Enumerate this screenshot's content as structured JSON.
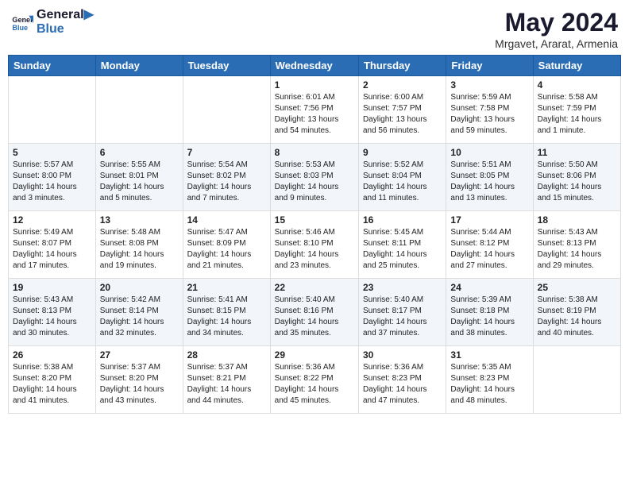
{
  "header": {
    "logo_line1": "General",
    "logo_line2": "Blue",
    "month_year": "May 2024",
    "location": "Mrgavet, Ararat, Armenia"
  },
  "days_of_week": [
    "Sunday",
    "Monday",
    "Tuesday",
    "Wednesday",
    "Thursday",
    "Friday",
    "Saturday"
  ],
  "weeks": [
    [
      {
        "day": "",
        "info": ""
      },
      {
        "day": "",
        "info": ""
      },
      {
        "day": "",
        "info": ""
      },
      {
        "day": "1",
        "info": "Sunrise: 6:01 AM\nSunset: 7:56 PM\nDaylight: 13 hours\nand 54 minutes."
      },
      {
        "day": "2",
        "info": "Sunrise: 6:00 AM\nSunset: 7:57 PM\nDaylight: 13 hours\nand 56 minutes."
      },
      {
        "day": "3",
        "info": "Sunrise: 5:59 AM\nSunset: 7:58 PM\nDaylight: 13 hours\nand 59 minutes."
      },
      {
        "day": "4",
        "info": "Sunrise: 5:58 AM\nSunset: 7:59 PM\nDaylight: 14 hours\nand 1 minute."
      }
    ],
    [
      {
        "day": "5",
        "info": "Sunrise: 5:57 AM\nSunset: 8:00 PM\nDaylight: 14 hours\nand 3 minutes."
      },
      {
        "day": "6",
        "info": "Sunrise: 5:55 AM\nSunset: 8:01 PM\nDaylight: 14 hours\nand 5 minutes."
      },
      {
        "day": "7",
        "info": "Sunrise: 5:54 AM\nSunset: 8:02 PM\nDaylight: 14 hours\nand 7 minutes."
      },
      {
        "day": "8",
        "info": "Sunrise: 5:53 AM\nSunset: 8:03 PM\nDaylight: 14 hours\nand 9 minutes."
      },
      {
        "day": "9",
        "info": "Sunrise: 5:52 AM\nSunset: 8:04 PM\nDaylight: 14 hours\nand 11 minutes."
      },
      {
        "day": "10",
        "info": "Sunrise: 5:51 AM\nSunset: 8:05 PM\nDaylight: 14 hours\nand 13 minutes."
      },
      {
        "day": "11",
        "info": "Sunrise: 5:50 AM\nSunset: 8:06 PM\nDaylight: 14 hours\nand 15 minutes."
      }
    ],
    [
      {
        "day": "12",
        "info": "Sunrise: 5:49 AM\nSunset: 8:07 PM\nDaylight: 14 hours\nand 17 minutes."
      },
      {
        "day": "13",
        "info": "Sunrise: 5:48 AM\nSunset: 8:08 PM\nDaylight: 14 hours\nand 19 minutes."
      },
      {
        "day": "14",
        "info": "Sunrise: 5:47 AM\nSunset: 8:09 PM\nDaylight: 14 hours\nand 21 minutes."
      },
      {
        "day": "15",
        "info": "Sunrise: 5:46 AM\nSunset: 8:10 PM\nDaylight: 14 hours\nand 23 minutes."
      },
      {
        "day": "16",
        "info": "Sunrise: 5:45 AM\nSunset: 8:11 PM\nDaylight: 14 hours\nand 25 minutes."
      },
      {
        "day": "17",
        "info": "Sunrise: 5:44 AM\nSunset: 8:12 PM\nDaylight: 14 hours\nand 27 minutes."
      },
      {
        "day": "18",
        "info": "Sunrise: 5:43 AM\nSunset: 8:13 PM\nDaylight: 14 hours\nand 29 minutes."
      }
    ],
    [
      {
        "day": "19",
        "info": "Sunrise: 5:43 AM\nSunset: 8:13 PM\nDaylight: 14 hours\nand 30 minutes."
      },
      {
        "day": "20",
        "info": "Sunrise: 5:42 AM\nSunset: 8:14 PM\nDaylight: 14 hours\nand 32 minutes."
      },
      {
        "day": "21",
        "info": "Sunrise: 5:41 AM\nSunset: 8:15 PM\nDaylight: 14 hours\nand 34 minutes."
      },
      {
        "day": "22",
        "info": "Sunrise: 5:40 AM\nSunset: 8:16 PM\nDaylight: 14 hours\nand 35 minutes."
      },
      {
        "day": "23",
        "info": "Sunrise: 5:40 AM\nSunset: 8:17 PM\nDaylight: 14 hours\nand 37 minutes."
      },
      {
        "day": "24",
        "info": "Sunrise: 5:39 AM\nSunset: 8:18 PM\nDaylight: 14 hours\nand 38 minutes."
      },
      {
        "day": "25",
        "info": "Sunrise: 5:38 AM\nSunset: 8:19 PM\nDaylight: 14 hours\nand 40 minutes."
      }
    ],
    [
      {
        "day": "26",
        "info": "Sunrise: 5:38 AM\nSunset: 8:20 PM\nDaylight: 14 hours\nand 41 minutes."
      },
      {
        "day": "27",
        "info": "Sunrise: 5:37 AM\nSunset: 8:20 PM\nDaylight: 14 hours\nand 43 minutes."
      },
      {
        "day": "28",
        "info": "Sunrise: 5:37 AM\nSunset: 8:21 PM\nDaylight: 14 hours\nand 44 minutes."
      },
      {
        "day": "29",
        "info": "Sunrise: 5:36 AM\nSunset: 8:22 PM\nDaylight: 14 hours\nand 45 minutes."
      },
      {
        "day": "30",
        "info": "Sunrise: 5:36 AM\nSunset: 8:23 PM\nDaylight: 14 hours\nand 47 minutes."
      },
      {
        "day": "31",
        "info": "Sunrise: 5:35 AM\nSunset: 8:23 PM\nDaylight: 14 hours\nand 48 minutes."
      },
      {
        "day": "",
        "info": ""
      }
    ]
  ]
}
